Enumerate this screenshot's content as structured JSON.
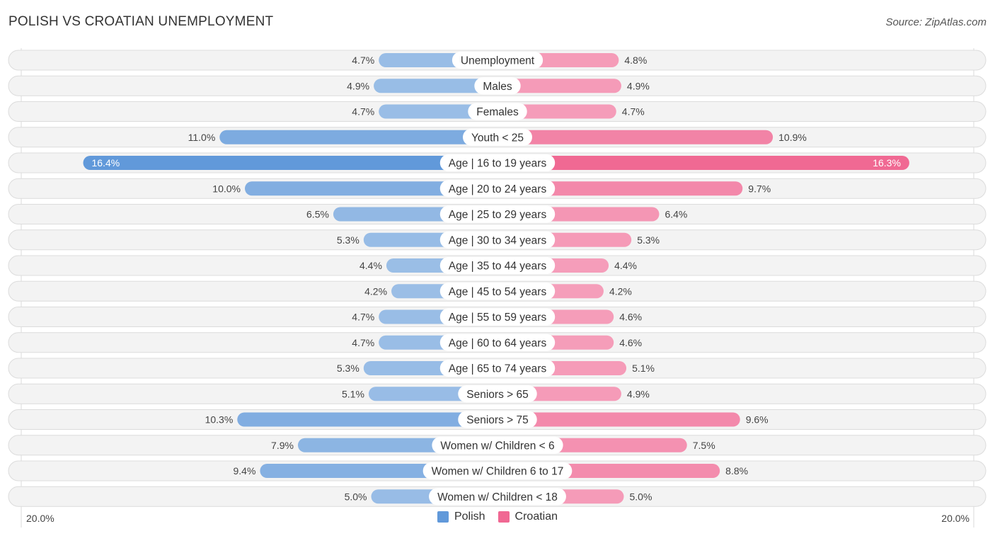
{
  "header": {
    "title": "POLISH VS CROATIAN UNEMPLOYMENT",
    "source": "Source: ZipAtlas.com"
  },
  "colors": {
    "polish_light": "#a7c6e9",
    "polish_strong": "#6199da",
    "croatian_light": "#f6a9c2",
    "croatian_strong": "#f06893"
  },
  "chart_data": {
    "type": "bar",
    "orientation": "horizontal-diverging",
    "title": "POLISH VS CROATIAN UNEMPLOYMENT",
    "xlabel": "",
    "ylabel": "",
    "xlim": [
      -20.0,
      20.0
    ],
    "axis_tick_labels": {
      "left": "20.0%",
      "right": "20.0%"
    },
    "legend_position": "bottom-center",
    "grid": false,
    "categories": [
      "Unemployment",
      "Males",
      "Females",
      "Youth < 25",
      "Age | 16 to 19 years",
      "Age | 20 to 24 years",
      "Age | 25 to 29 years",
      "Age | 30 to 34 years",
      "Age | 35 to 44 years",
      "Age | 45 to 54 years",
      "Age | 55 to 59 years",
      "Age | 60 to 64 years",
      "Age | 65 to 74 years",
      "Seniors > 65",
      "Seniors > 75",
      "Women w/ Children < 6",
      "Women w/ Children 6 to 17",
      "Women w/ Children < 18"
    ],
    "series": [
      {
        "name": "Polish",
        "side": "left",
        "values": [
          4.7,
          4.9,
          4.7,
          11.0,
          16.4,
          10.0,
          6.5,
          5.3,
          4.4,
          4.2,
          4.7,
          4.7,
          5.3,
          5.1,
          10.3,
          7.9,
          9.4,
          5.0
        ],
        "labels": [
          "4.7%",
          "4.9%",
          "4.7%",
          "11.0%",
          "16.4%",
          "10.0%",
          "6.5%",
          "5.3%",
          "4.4%",
          "4.2%",
          "4.7%",
          "4.7%",
          "5.3%",
          "5.1%",
          "10.3%",
          "7.9%",
          "9.4%",
          "5.0%"
        ]
      },
      {
        "name": "Croatian",
        "side": "right",
        "values": [
          4.8,
          4.9,
          4.7,
          10.9,
          16.3,
          9.7,
          6.4,
          5.3,
          4.4,
          4.2,
          4.6,
          4.6,
          5.1,
          4.9,
          9.6,
          7.5,
          8.8,
          5.0
        ],
        "labels": [
          "4.8%",
          "4.9%",
          "4.7%",
          "10.9%",
          "16.3%",
          "9.7%",
          "6.4%",
          "5.3%",
          "4.4%",
          "4.2%",
          "4.6%",
          "4.6%",
          "5.1%",
          "4.9%",
          "9.6%",
          "7.5%",
          "8.8%",
          "5.0%"
        ]
      }
    ]
  },
  "legend": {
    "items": [
      {
        "label": "Polish"
      },
      {
        "label": "Croatian"
      }
    ]
  },
  "axis": {
    "left_label": "20.0%",
    "right_label": "20.0%"
  }
}
